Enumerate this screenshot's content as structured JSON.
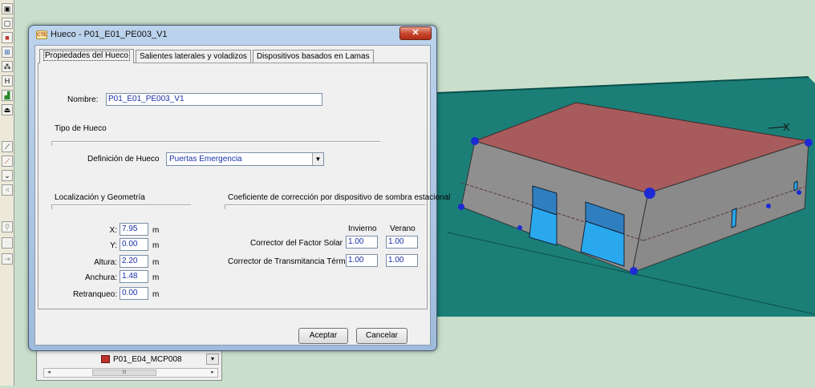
{
  "toolbar": {
    "tools": [
      {
        "icon": "select-window-icon",
        "glyph": "▣"
      },
      {
        "icon": "window-icon",
        "glyph": "▢"
      },
      {
        "icon": "wall-red-icon",
        "glyph": "■"
      },
      {
        "icon": "grid-window-icon",
        "glyph": "⊞"
      },
      {
        "icon": "sparkle-icon",
        "glyph": "⁂"
      },
      {
        "icon": "columns-icon",
        "glyph": "H"
      },
      {
        "icon": "shade-green-icon",
        "glyph": "▟"
      },
      {
        "icon": "roof-icon",
        "glyph": "⏏"
      },
      {
        "icon": "line-diagonal-icon",
        "glyph": "⟋"
      },
      {
        "icon": "line-red-icon",
        "glyph": "⟋"
      },
      {
        "icon": "polyline-icon",
        "glyph": "⌄"
      },
      {
        "icon": "polygon-node-icon",
        "glyph": "⁖"
      },
      {
        "icon": "person-icon",
        "glyph": "⚲"
      },
      {
        "icon": "lasso-icon",
        "glyph": "◌"
      },
      {
        "icon": "arrow-right-icon",
        "glyph": "⇥"
      }
    ]
  },
  "bottom_panel": {
    "item_label": "P01_E04_MCP008",
    "dropdown_arrow": "▾",
    "scroll_left": "◂",
    "scroll_right": "▸",
    "scroll_thumb": "III"
  },
  "dialog": {
    "title": "Hueco - P01_E01_PE003_V1",
    "icon_text": "CTE",
    "close_glyph": "✕",
    "tabs": [
      "Propiedades del Hueco",
      "Salientes laterales y voladizos",
      "Dispositivos basados en Lamas"
    ],
    "nombre_label": "Nombre:",
    "nombre_value": "P01_E01_PE003_V1",
    "tipo_heading": "Tipo de Hueco",
    "definicion_label": "Definición de Hueco",
    "definicion_value": "Puertas Emergencia",
    "localizacion_heading": "Localización y Geometría",
    "coeficiente_heading": "Coeficiente de corrección por dispositivo de sombra estacional",
    "geometry": [
      {
        "label": "X:",
        "value": "7.95",
        "unit": "m"
      },
      {
        "label": "Y:",
        "value": "0.00",
        "unit": "m"
      },
      {
        "label": "Altura:",
        "value": "2.20",
        "unit": "m"
      },
      {
        "label": "Anchura:",
        "value": "1.48",
        "unit": "m"
      },
      {
        "label": "Retranqueo:",
        "value": "0.00",
        "unit": "m"
      }
    ],
    "invierno_label": "Invierno",
    "verano_label": "Verano",
    "corrector_solar_label": "Corrector del Factor Solar",
    "corrector_solar_invierno": "1.00",
    "corrector_solar_verano": "1.00",
    "corrector_trans_label": "Corrector de Transmitancia Térmica",
    "corrector_trans_invierno": "1.00",
    "corrector_trans_verano": "1.00",
    "aceptar": "Aceptar",
    "cancelar": "Cancelar"
  },
  "scene": {
    "axis_marker": "X",
    "colors": {
      "background": "#c9dfcc",
      "ground": "#1b7f78",
      "roof": "#a85b5c",
      "walls": "#8f8f8f",
      "windows": "#2f9bde",
      "nodes": "#1c2ad4"
    }
  }
}
